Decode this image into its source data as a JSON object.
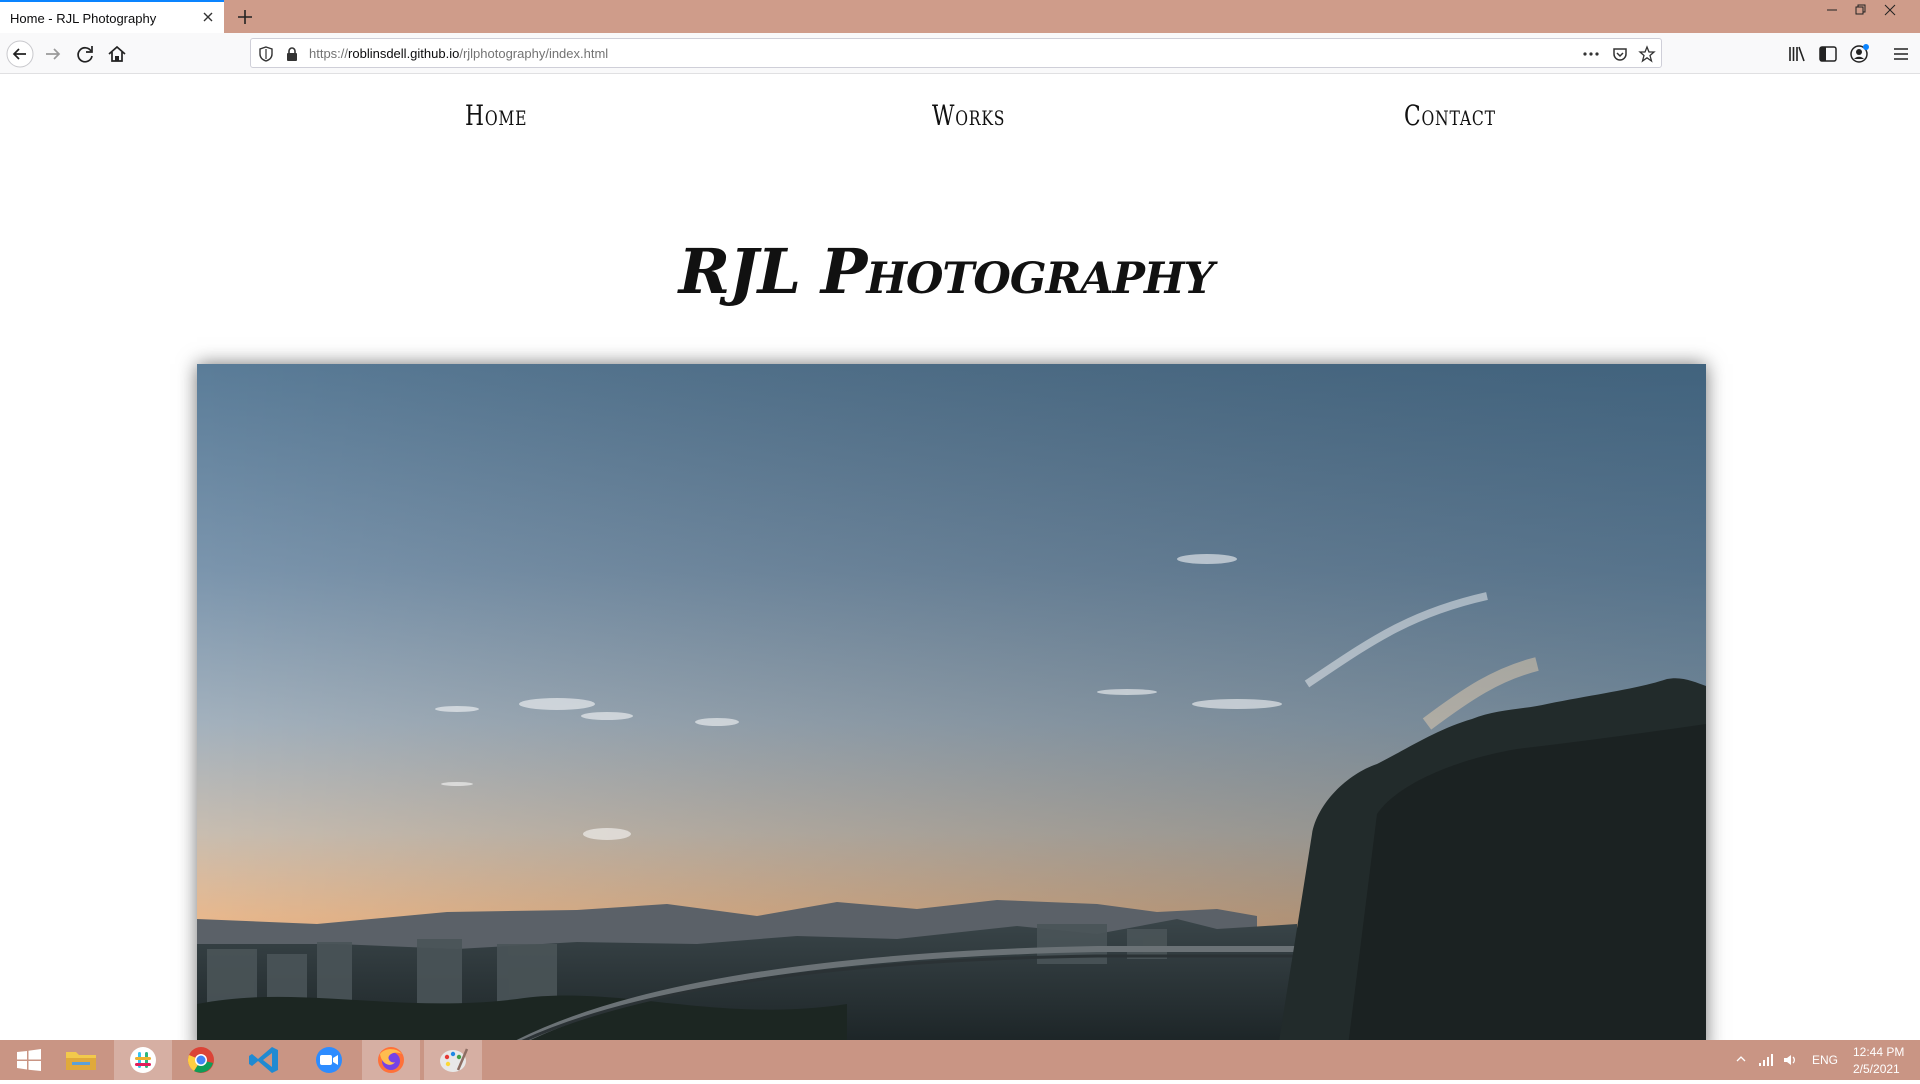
{
  "browser": {
    "tab": {
      "title": "Home - RJL Photography"
    },
    "url": {
      "prefix": "https://",
      "host": "roblinsdell.github.io",
      "path": "/rjlphotography/index.html"
    }
  },
  "site": {
    "nav": [
      {
        "label": "Home"
      },
      {
        "label": "Works"
      },
      {
        "label": "Contact"
      }
    ],
    "title": "RJL Photography"
  },
  "taskbar": {
    "apps": [
      {
        "name": "windows-start"
      },
      {
        "name": "file-explorer"
      },
      {
        "name": "slack"
      },
      {
        "name": "chrome"
      },
      {
        "name": "vscode"
      },
      {
        "name": "zoom"
      },
      {
        "name": "firefox"
      },
      {
        "name": "paint"
      }
    ],
    "tray": {
      "language": "ENG",
      "time": "12:44 PM",
      "date": "2/5/2021"
    }
  },
  "colors": {
    "tabstrip": "#cf9c8a",
    "accent": "#0a84ff",
    "taskbar": "#c99584"
  }
}
